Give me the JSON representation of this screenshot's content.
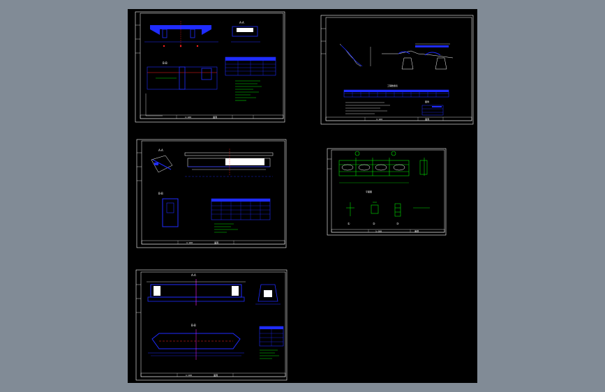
{
  "sheets": [
    {
      "id": "s1",
      "scale_label": "1:100",
      "title_label": "涵洞",
      "label_a": "A-A",
      "label_b": "B-B"
    },
    {
      "id": "s2",
      "scale_label": "1:100",
      "title_label": "涵洞",
      "table_title": "工程数量表",
      "legend_title": "图例"
    },
    {
      "id": "s3",
      "scale_label": "1:100",
      "title_label": "涵洞",
      "label_a": "A-A",
      "label_b": "B-B"
    },
    {
      "id": "s4",
      "scale_label": "1:100",
      "title_label": "涵洞",
      "label_main": "平面图",
      "detail_a": "①",
      "detail_b": "②",
      "detail_c": "③"
    },
    {
      "id": "s5",
      "scale_label": "1:100",
      "title_label": "涵洞",
      "label_a": "A-A",
      "label_b": "B-B"
    }
  ],
  "colors": {
    "background": "#818b96",
    "viewport": "#000000",
    "frame": "#ffffff",
    "blue": "#1f2cff",
    "green": "#00e000",
    "red": "#ff2020",
    "magenta": "#ff20ff",
    "cyan": "#20c8ff"
  }
}
